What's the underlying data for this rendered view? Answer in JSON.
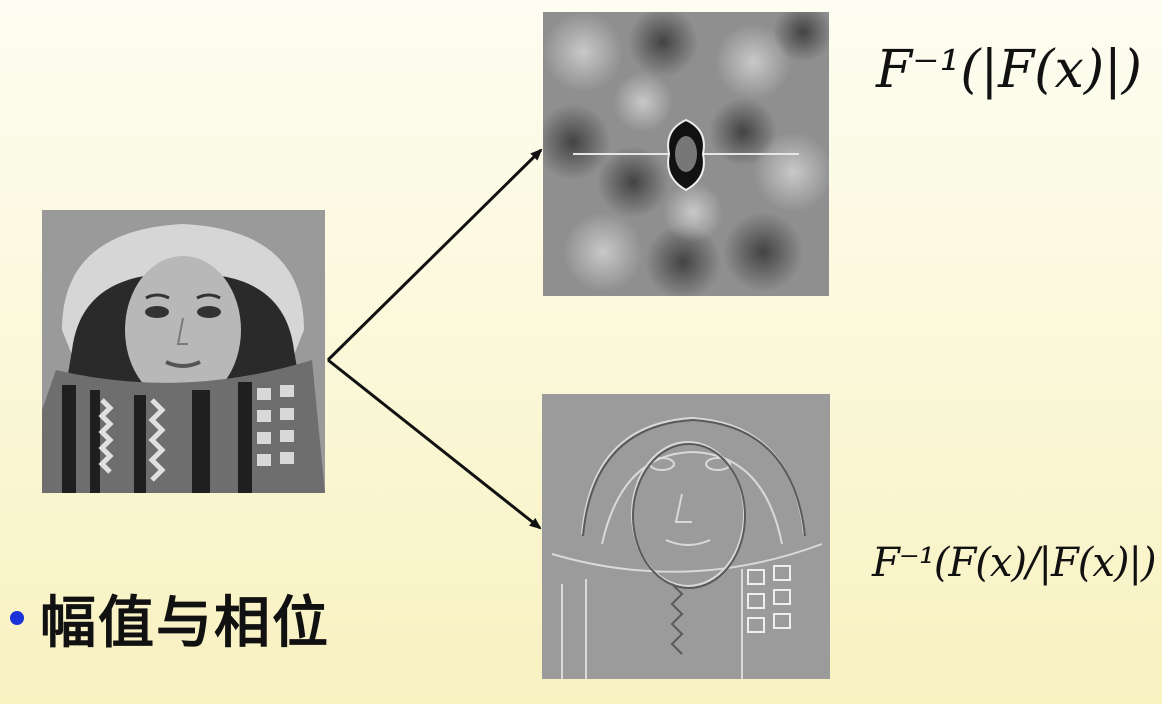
{
  "slide": {
    "title": "幅值与相位",
    "bullet_color": "#1a33d9",
    "background_top": "#fdfdf2",
    "background_bottom": "#f8f1c0"
  },
  "images": {
    "original": {
      "description_icon": "face-photo-grayscale"
    },
    "amplitude_only": {
      "description_icon": "amplitude-reconstruction"
    },
    "phase_only": {
      "description_icon": "phase-reconstruction"
    }
  },
  "formulas": {
    "amplitude": "F⁻¹(|F(x)|)",
    "phase": "F⁻¹(F(x)/|F(x)|)"
  }
}
